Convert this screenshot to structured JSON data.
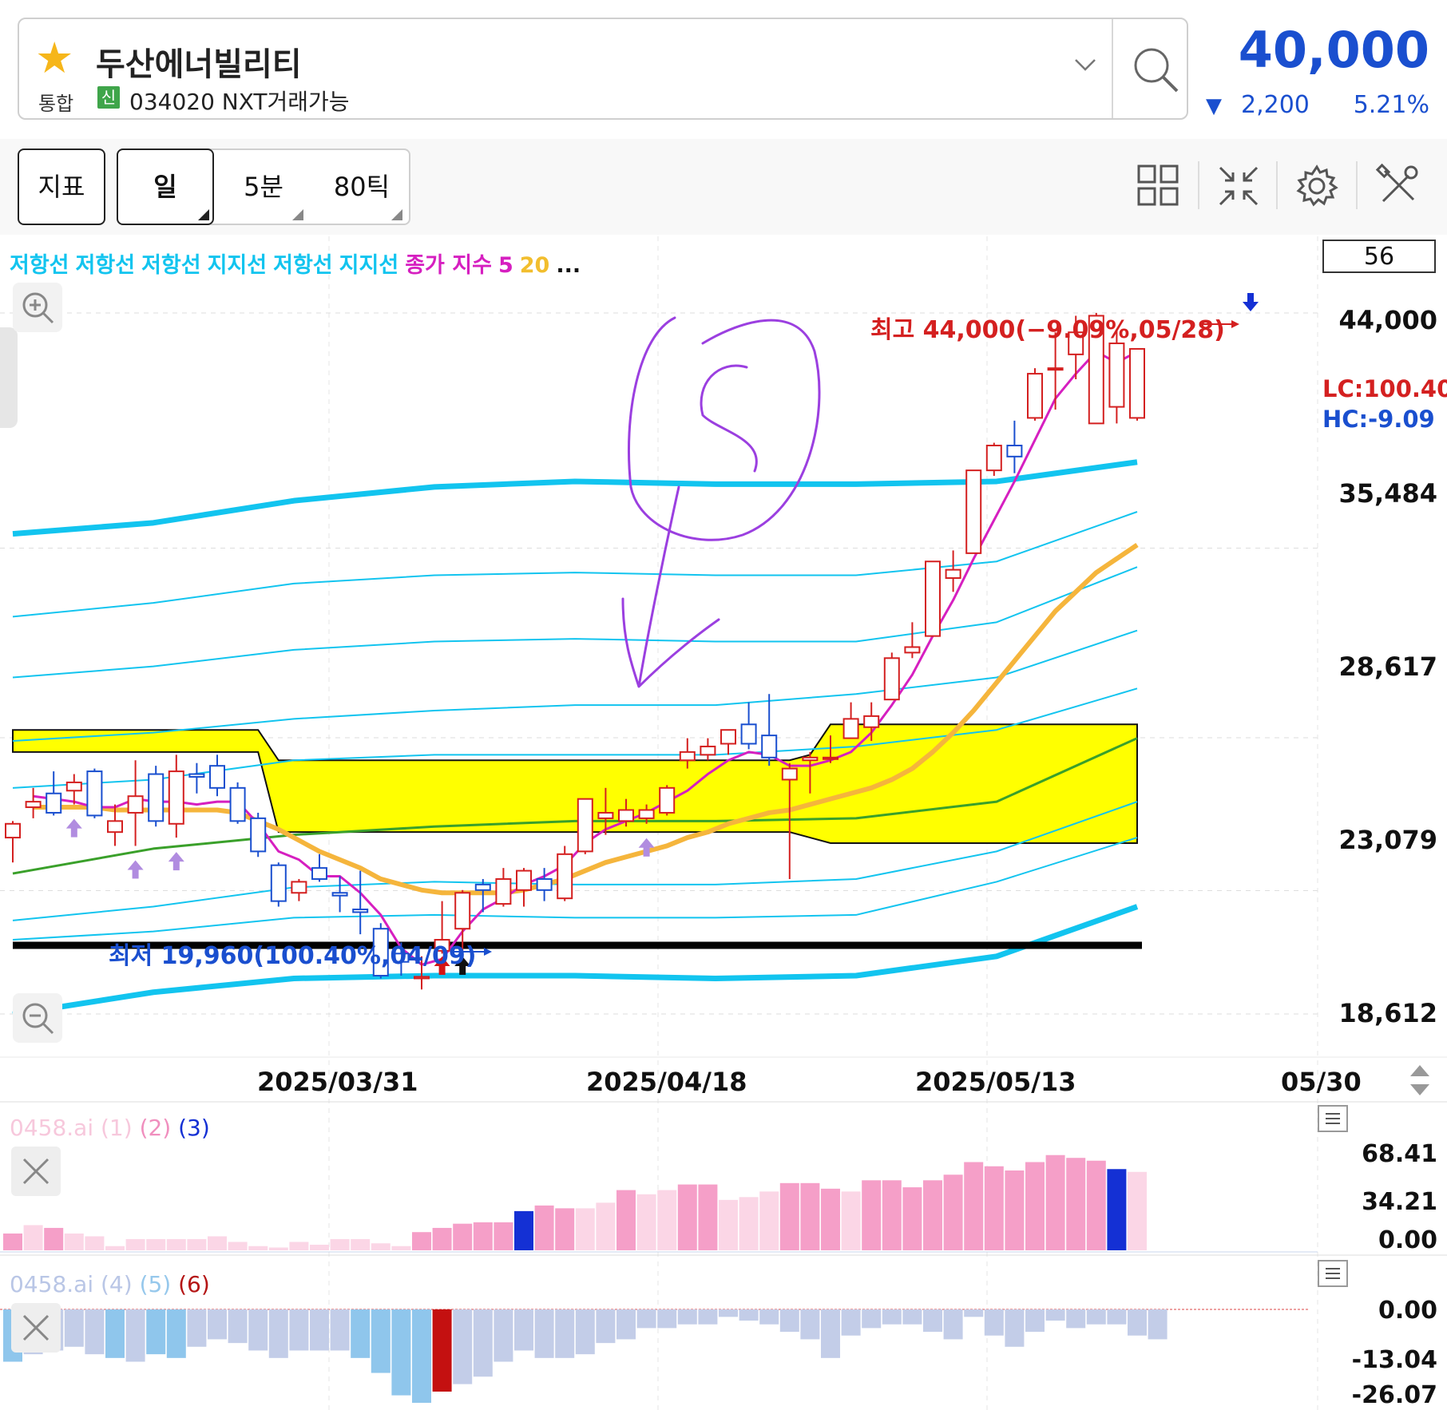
{
  "header": {
    "stock_name": "두산에너빌리티",
    "market": "통합",
    "badge": "신",
    "code_info": "034020 NXT거래가능",
    "price": "40,000",
    "change_amount": "2,200",
    "change_pct": "5.21%",
    "change_direction": "down",
    "price_color": "#1a4fcf"
  },
  "toolbar": {
    "indicator_label": "지표",
    "day_label": "일",
    "min5_label": "5분",
    "tick80_label": "80틱",
    "icons": [
      "grid-layout-icon",
      "collapse-icon",
      "gear-icon",
      "tools-icon"
    ]
  },
  "chart_data": {
    "type": "candlestick",
    "legend": [
      {
        "text": "저항선",
        "color": "#12c4ef"
      },
      {
        "text": "저항선",
        "color": "#12c4ef"
      },
      {
        "text": "저항선",
        "color": "#12c4ef"
      },
      {
        "text": "지지선",
        "color": "#12c4ef"
      },
      {
        "text": "저항선",
        "color": "#12c4ef"
      },
      {
        "text": "지지선",
        "color": "#12c4ef"
      },
      {
        "text": "종가 지수",
        "color": "#d61fc0"
      },
      {
        "text": "5",
        "color": "#d61fc0"
      },
      {
        "text": "20",
        "color": "#f2be2e"
      },
      {
        "text": "...",
        "color": "#111111"
      }
    ],
    "visible_count": "56",
    "y_ticks": [
      "44,000",
      "35,484",
      "28,617",
      "23,079",
      "18,612"
    ],
    "y_tick_values": [
      44000,
      35484,
      28617,
      23079,
      18612
    ],
    "x_ticks": [
      "2025/03/31",
      "2025/04/18",
      "2025/05/13",
      "05/30"
    ],
    "lc_label": "LC:100.40",
    "hc_label": "HC:-9.09",
    "high_annotation": "최고 44,000(−9.09%,05/28)",
    "low_annotation": "최저 19,960(100.40%,04/09)",
    "up_color": "#d42020",
    "down_color": "#1a4fcf",
    "candles": [
      {
        "o": 25000,
        "h": 25600,
        "l": 24100,
        "c": 25500
      },
      {
        "o": 26100,
        "h": 26800,
        "l": 25700,
        "c": 26300
      },
      {
        "o": 26600,
        "h": 27400,
        "l": 25800,
        "c": 25900
      },
      {
        "o": 26700,
        "h": 27300,
        "l": 26200,
        "c": 27000
      },
      {
        "o": 27400,
        "h": 27500,
        "l": 25700,
        "c": 25800
      },
      {
        "o": 25200,
        "h": 26200,
        "l": 24700,
        "c": 25600
      },
      {
        "o": 25900,
        "h": 27800,
        "l": 24700,
        "c": 26500
      },
      {
        "o": 27300,
        "h": 27600,
        "l": 25400,
        "c": 25600
      },
      {
        "o": 25500,
        "h": 28000,
        "l": 25000,
        "c": 27400
      },
      {
        "o": 27300,
        "h": 27700,
        "l": 26600,
        "c": 27200
      },
      {
        "o": 27600,
        "h": 28000,
        "l": 26500,
        "c": 26800
      },
      {
        "o": 26800,
        "h": 27000,
        "l": 25500,
        "c": 25600
      },
      {
        "o": 25700,
        "h": 25900,
        "l": 24300,
        "c": 24500
      },
      {
        "o": 24000,
        "h": 24100,
        "l": 22500,
        "c": 22700
      },
      {
        "o": 23000,
        "h": 23500,
        "l": 22700,
        "c": 23400
      },
      {
        "o": 23900,
        "h": 24400,
        "l": 23400,
        "c": 23500
      },
      {
        "o": 23000,
        "h": 23600,
        "l": 22300,
        "c": 22900
      },
      {
        "o": 22400,
        "h": 23800,
        "l": 21500,
        "c": 22300
      },
      {
        "o": 21700,
        "h": 21900,
        "l": 19900,
        "c": 20000
      },
      {
        "o": 20800,
        "h": 21200,
        "l": 20000,
        "c": 20500
      },
      {
        "o": 19900,
        "h": 20700,
        "l": 19500,
        "c": 19960
      },
      {
        "o": 20900,
        "h": 22700,
        "l": 20800,
        "c": 21300
      },
      {
        "o": 21700,
        "h": 23100,
        "l": 20800,
        "c": 23000
      },
      {
        "o": 23300,
        "h": 23500,
        "l": 22300,
        "c": 23100
      },
      {
        "o": 22600,
        "h": 23900,
        "l": 22500,
        "c": 23500
      },
      {
        "o": 23100,
        "h": 23900,
        "l": 22500,
        "c": 23800
      },
      {
        "o": 23500,
        "h": 23900,
        "l": 22700,
        "c": 23100
      },
      {
        "o": 22800,
        "h": 24700,
        "l": 22700,
        "c": 24400
      },
      {
        "o": 24500,
        "h": 26400,
        "l": 24400,
        "c": 26400
      },
      {
        "o": 25700,
        "h": 26800,
        "l": 25100,
        "c": 25900
      },
      {
        "o": 25600,
        "h": 26400,
        "l": 25400,
        "c": 26000
      },
      {
        "o": 25700,
        "h": 26200,
        "l": 25500,
        "c": 26000
      },
      {
        "o": 25900,
        "h": 26900,
        "l": 25800,
        "c": 26800
      },
      {
        "o": 27800,
        "h": 28600,
        "l": 27500,
        "c": 28100
      },
      {
        "o": 28000,
        "h": 28600,
        "l": 27800,
        "c": 28300
      },
      {
        "o": 28400,
        "h": 28900,
        "l": 28000,
        "c": 28900
      },
      {
        "o": 29100,
        "h": 29900,
        "l": 28200,
        "c": 28400
      },
      {
        "o": 28700,
        "h": 30200,
        "l": 27600,
        "c": 27900
      },
      {
        "o": 27100,
        "h": 27700,
        "l": 23500,
        "c": 27500
      },
      {
        "o": 27800,
        "h": 28100,
        "l": 26600,
        "c": 27900
      },
      {
        "o": 27900,
        "h": 28700,
        "l": 27700,
        "c": 27900
      },
      {
        "o": 28600,
        "h": 29900,
        "l": 28600,
        "c": 29300
      },
      {
        "o": 29000,
        "h": 29900,
        "l": 28500,
        "c": 29400
      },
      {
        "o": 30000,
        "h": 31700,
        "l": 30000,
        "c": 31500
      },
      {
        "o": 31700,
        "h": 32800,
        "l": 31500,
        "c": 31900
      },
      {
        "o": 32300,
        "h": 34900,
        "l": 32300,
        "c": 35000
      },
      {
        "o": 34400,
        "h": 35400,
        "l": 33900,
        "c": 34700
      },
      {
        "o": 35300,
        "h": 38300,
        "l": 35300,
        "c": 38300
      },
      {
        "o": 38300,
        "h": 39300,
        "l": 38100,
        "c": 39200
      },
      {
        "o": 39200,
        "h": 40100,
        "l": 38200,
        "c": 38800
      },
      {
        "o": 40200,
        "h": 42000,
        "l": 40100,
        "c": 41800
      },
      {
        "o": 42000,
        "h": 43300,
        "l": 40500,
        "c": 42000
      },
      {
        "o": 42500,
        "h": 43900,
        "l": 41600,
        "c": 43300
      },
      {
        "o": 40000,
        "h": 44000,
        "l": 40000,
        "c": 43900
      },
      {
        "o": 40600,
        "h": 43400,
        "l": 40000,
        "c": 42900
      },
      {
        "o": 40200,
        "h": 42700,
        "l": 40100,
        "c": 42700
      }
    ],
    "ma5": [
      null,
      26500,
      26400,
      26300,
      26100,
      26100,
      26400,
      26300,
      26300,
      26200,
      26300,
      26300,
      25500,
      24500,
      24200,
      23600,
      23600,
      23000,
      22200,
      21000,
      20400,
      20600,
      21600,
      22400,
      22800,
      23300,
      23600,
      24000,
      24800,
      25300,
      25600,
      25900,
      26300,
      26700,
      27300,
      27800,
      28100,
      28000,
      27600,
      27600,
      27800,
      28100,
      28800,
      29800,
      30900,
      32300,
      33600,
      35100,
      36500,
      37900,
      39400,
      40900,
      41800,
      42600,
      42200,
      42600
    ],
    "ma20": [
      null,
      26100,
      26100,
      26100,
      26100,
      26000,
      26000,
      26000,
      26000,
      26000,
      26000,
      25900,
      25600,
      25300,
      24900,
      24500,
      24200,
      23900,
      23500,
      23300,
      23100,
      23000,
      23000,
      23000,
      23000,
      23100,
      23300,
      23500,
      23800,
      24100,
      24300,
      24500,
      24700,
      25000,
      25200,
      25500,
      25700,
      25900,
      26000,
      26200,
      26400,
      26600,
      26800,
      27100,
      27500,
      28100,
      28800,
      29600,
      30500,
      31400,
      32300,
      33200,
      33900,
      34600,
      35100,
      35600
    ],
    "lines": [
      {
        "name": "저항선",
        "color": "#12c4ef",
        "width": 7,
        "values": [
          36000,
          36400,
          37200,
          37700,
          37900,
          37800,
          37800,
          37900,
          38600
        ]
      },
      {
        "name": "저항선",
        "color": "#12c4ef",
        "width": 2,
        "values": [
          33000,
          33500,
          34200,
          34500,
          34600,
          34500,
          34500,
          35000,
          36800
        ]
      },
      {
        "name": "저항선",
        "color": "#12c4ef",
        "width": 2,
        "values": [
          30800,
          31200,
          31800,
          32100,
          32200,
          32100,
          32100,
          32800,
          34800
        ]
      },
      {
        "name": "지지선",
        "color": "#12c4ef",
        "width": 2,
        "values": [
          28500,
          28800,
          29300,
          29600,
          29800,
          29800,
          30200,
          30800,
          32500
        ]
      },
      {
        "name": "저항선",
        "color": "#12c4ef",
        "width": 2,
        "values": [
          26800,
          27100,
          27800,
          28000,
          28000,
          28000,
          28300,
          28900,
          30400
        ]
      },
      {
        "name": "지지선",
        "color": "#12c4ef",
        "width": 2,
        "values": [
          22000,
          22500,
          23200,
          23400,
          23300,
          23300,
          23500,
          24500,
          26300
        ]
      },
      {
        "name": "지지선",
        "color": "#12c4ef",
        "width": 2,
        "values": [
          21300,
          21600,
          22100,
          22200,
          22100,
          22100,
          22200,
          23400,
          25000
        ]
      },
      {
        "name": "지지선",
        "color": "#12c4ef",
        "width": 7,
        "values": [
          18600,
          19400,
          19900,
          20000,
          20000,
          19900,
          20000,
          20700,
          22500
        ]
      },
      {
        "name": "60",
        "color": "#3aa02a",
        "width": 3,
        "values": [
          23700,
          24600,
          25100,
          25400,
          25600,
          25600,
          25700,
          26300,
          28600
        ]
      }
    ],
    "cloud": {
      "upper": [
        [
          0,
          28900
        ],
        [
          12,
          28900
        ],
        [
          13,
          27800
        ],
        [
          38,
          27800
        ],
        [
          39,
          28000
        ],
        [
          40,
          29100
        ],
        [
          55,
          29100
        ]
      ],
      "lower": [
        [
          0,
          28100
        ],
        [
          12,
          28100
        ],
        [
          13,
          25200
        ],
        [
          38,
          25200
        ],
        [
          39,
          25000
        ],
        [
          40,
          24800
        ],
        [
          55,
          24800
        ]
      ],
      "color": "#ffff00"
    },
    "support_level": 21100,
    "purple_arrows": [
      3,
      6,
      8,
      31
    ],
    "signal_arrows": [
      {
        "i": 21,
        "color": "#d41515"
      },
      {
        "i": 22,
        "color": "#111111"
      }
    ],
    "ind1": {
      "title_parts": [
        {
          "text": "0458.ai (1)",
          "color": "#f7c8dc"
        },
        {
          "text": "(2)",
          "color": "#f08fbe"
        },
        {
          "text": "(3)",
          "color": "#1430d4"
        }
      ],
      "y_ticks": [
        "68.41",
        "34.21",
        "0.00"
      ],
      "y_tick_values": [
        68.41,
        34.21,
        0.0
      ],
      "values": [
        12,
        18,
        16,
        12,
        10,
        3,
        8,
        8,
        8,
        8,
        10,
        6,
        3,
        2,
        6,
        4,
        8,
        8,
        5,
        3,
        13,
        16,
        19,
        20,
        20,
        28,
        32,
        30,
        30,
        34,
        43,
        40,
        43,
        47,
        47,
        36,
        38,
        42,
        48,
        48,
        44,
        42,
        50,
        50,
        45,
        50,
        54,
        63,
        60,
        57,
        63,
        68,
        66,
        64,
        58,
        56
      ],
      "colors": [
        "p2",
        "p1",
        "p2",
        "p1",
        "p1",
        "p1",
        "p1",
        "p1",
        "p1",
        "p1",
        "p1",
        "p1",
        "p1",
        "p1",
        "p1",
        "p1",
        "p1",
        "p1",
        "p1",
        "p1",
        "p2",
        "p2",
        "p2",
        "p2",
        "p2",
        "p3",
        "p2",
        "p2",
        "p1",
        "p1",
        "p2",
        "p1",
        "p1",
        "p2",
        "p2",
        "p1",
        "p1",
        "p1",
        "p2",
        "p2",
        "p2",
        "p1",
        "p2",
        "p2",
        "p2",
        "p2",
        "p2",
        "p2",
        "p2",
        "p2",
        "p2",
        "p2",
        "p2",
        "p2",
        "p3",
        "p1"
      ]
    },
    "ind2": {
      "title_parts": [
        {
          "text": "0458.ai (4)",
          "color": "#b9c6e6"
        },
        {
          "text": "(5)",
          "color": "#96c8ec"
        },
        {
          "text": "(6)",
          "color": "#b41414"
        }
      ],
      "y_ticks": [
        "0.00",
        "-13.04",
        "-26.07"
      ],
      "y_tick_values": [
        0.0,
        -13.04,
        -26.07
      ],
      "values": [
        -14,
        -12,
        -11,
        -10,
        -12,
        -13,
        -14,
        -12,
        -13,
        -10,
        -8,
        -9,
        -11,
        -13,
        -11,
        -11,
        -11,
        -13,
        -17,
        -23,
        -25,
        -22,
        -20,
        -18,
        -14,
        -11,
        -13,
        -13,
        -12,
        -9,
        -8,
        -5,
        -5,
        -4,
        -4,
        -2,
        -3,
        -4,
        -6,
        -8,
        -13,
        -7,
        -5,
        -4,
        -4,
        -6,
        -8,
        -2,
        -7,
        -10,
        -6,
        -3,
        -5,
        -4,
        -4,
        -7,
        -8
      ],
      "colors": [
        "b5",
        "b4",
        "b4",
        "b4",
        "b4",
        "b5",
        "b4",
        "b5",
        "b5",
        "b4",
        "b4",
        "b4",
        "b4",
        "b4",
        "b4",
        "b4",
        "b4",
        "b5",
        "b5",
        "b5",
        "b5",
        "b6",
        "b4",
        "b4",
        "b4",
        "b4",
        "b4",
        "b4",
        "b4",
        "b4",
        "b4",
        "b4",
        "b4",
        "b4",
        "b4",
        "b4",
        "b4",
        "b4",
        "b4",
        "b4",
        "b4",
        "b4",
        "b4",
        "b4",
        "b4",
        "b4",
        "b4",
        "b4",
        "b4",
        "b4",
        "b4",
        "b4",
        "b4",
        "b4",
        "b4",
        "b4",
        "b4"
      ]
    }
  }
}
